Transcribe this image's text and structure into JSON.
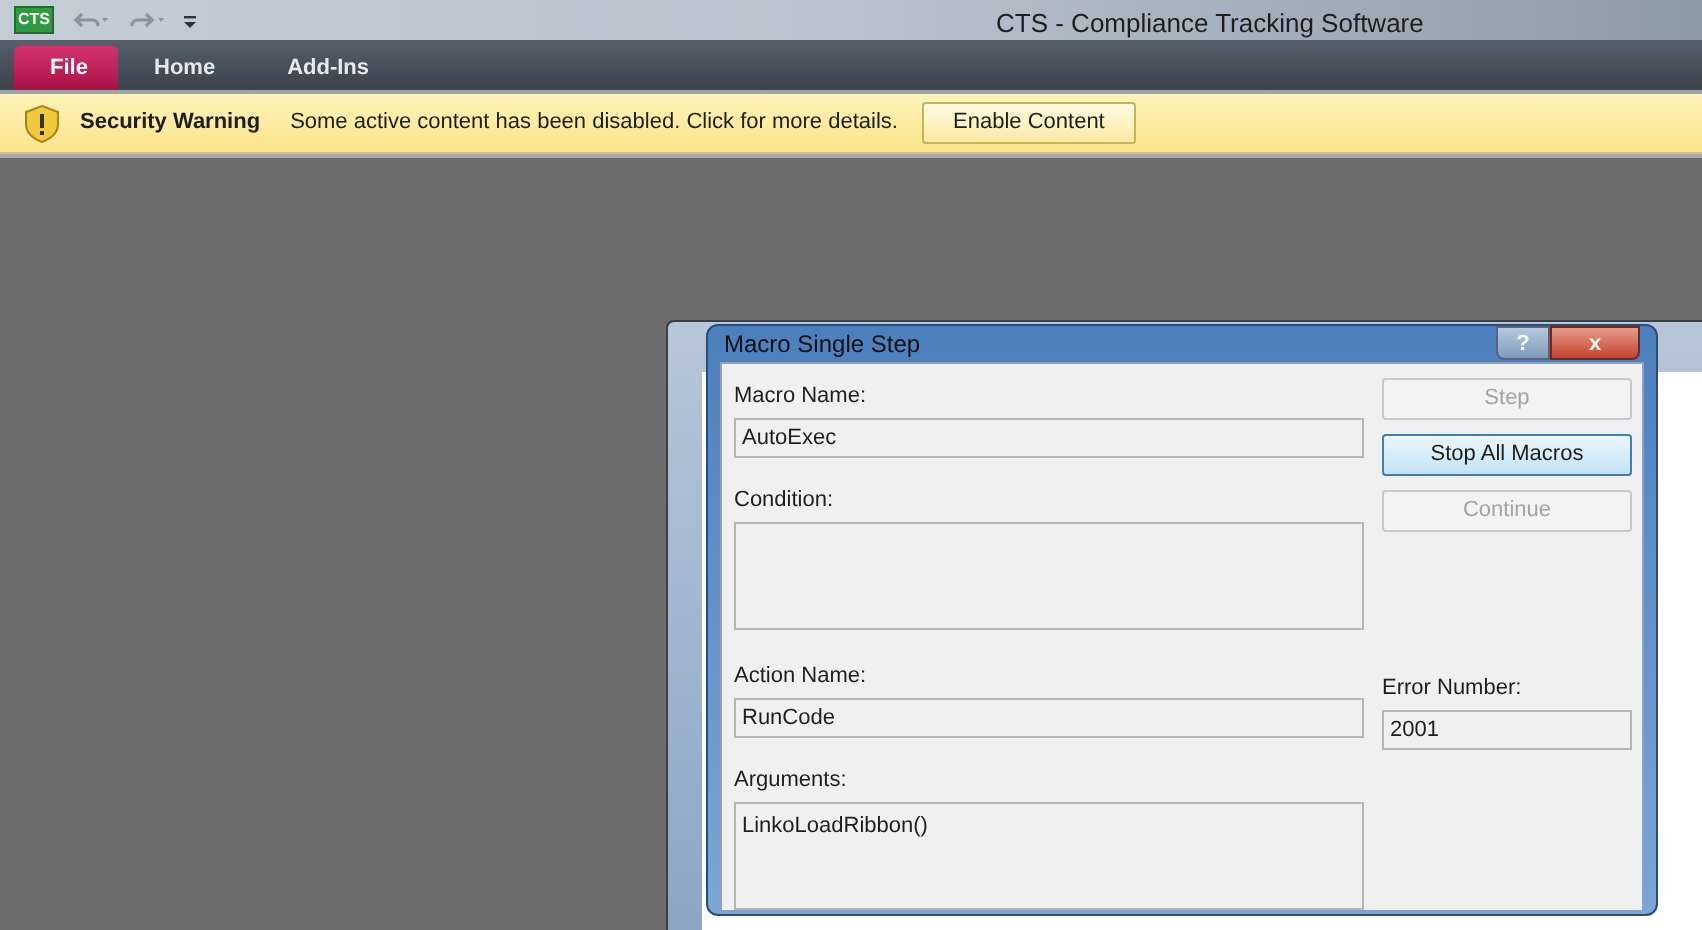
{
  "app": {
    "logo": "CTS",
    "title": "CTS - Compliance Tracking Software"
  },
  "tabs": [
    {
      "label": "File",
      "selected": true
    },
    {
      "label": "Home",
      "selected": false
    },
    {
      "label": "Add-Ins",
      "selected": false
    }
  ],
  "message_bar": {
    "title": "Security Warning",
    "message": "Some active content has been disabled. Click for more details.",
    "button": "Enable Content"
  },
  "dialog": {
    "title": "Macro Single Step",
    "help": "?",
    "close": "x",
    "macro_name": {
      "label": "Macro Name:",
      "value": "AutoExec"
    },
    "condition": {
      "label": "Condition:"
    },
    "action_name": {
      "label": "Action Name:",
      "value": "RunCode"
    },
    "arguments": {
      "label": "Arguments:",
      "value": "LinkoLoadRibbon()"
    },
    "error_number": {
      "label": "Error Number:",
      "value": "2001"
    },
    "buttons": [
      {
        "label": "Step",
        "disabled": true,
        "focused": false
      },
      {
        "label": "Stop All Macros",
        "disabled": false,
        "focused": true
      },
      {
        "label": "Continue",
        "disabled": true,
        "focused": false
      }
    ]
  }
}
